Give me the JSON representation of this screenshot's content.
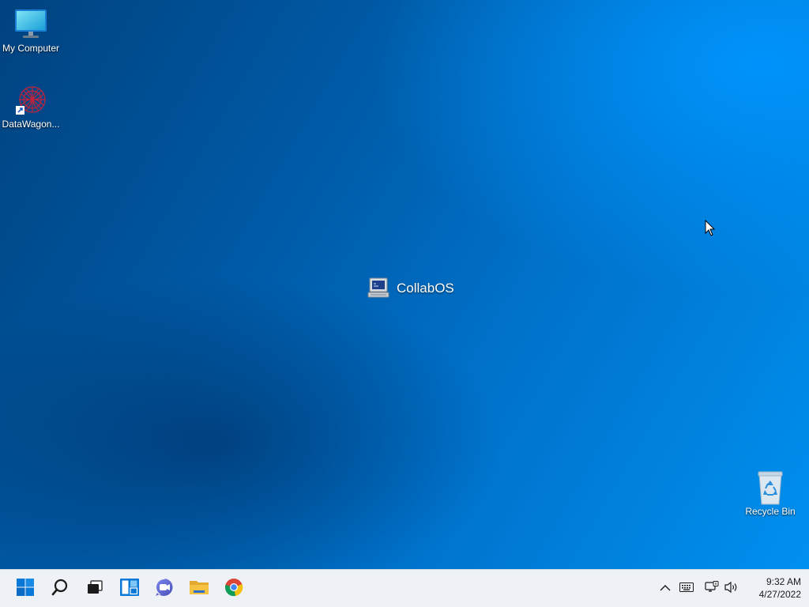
{
  "desktop": {
    "icons": [
      {
        "label": "My Computer",
        "icon": "monitor-icon"
      },
      {
        "label": "DataWagon...",
        "icon": "datawagon-icon"
      },
      {
        "label": "Recycle Bin",
        "icon": "recycle-bin-icon"
      }
    ],
    "center_item": {
      "label": "CollabOS",
      "icon": "computer-terminal-icon"
    }
  },
  "taskbar": {
    "buttons": [
      {
        "name": "start",
        "icon": "windows-start-icon"
      },
      {
        "name": "search",
        "icon": "search-icon"
      },
      {
        "name": "task-view",
        "icon": "task-view-icon"
      },
      {
        "name": "widgets",
        "icon": "widgets-icon"
      },
      {
        "name": "chat",
        "icon": "teams-chat-icon"
      },
      {
        "name": "file-explorer",
        "icon": "folder-icon"
      },
      {
        "name": "chrome",
        "icon": "chrome-icon"
      }
    ],
    "tray": {
      "icons": [
        "chevron-up-icon",
        "keyboard-icon",
        "network-icon",
        "volume-icon"
      ],
      "time": "9:32 AM",
      "date": "4/27/2022"
    }
  },
  "colors": {
    "taskbar_bg": "#eef1f5",
    "start_blue": "#0a78d7",
    "folder_yellow": "#f5c242"
  }
}
